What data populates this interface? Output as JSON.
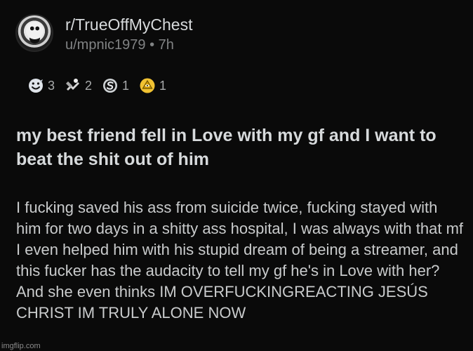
{
  "post": {
    "subreddit": "r/TrueOffMyChest",
    "author": "u/mpnic1979",
    "separator": "•",
    "age": "7h",
    "title": "my best friend fell in Love with my gf and I want to beat the shit out of him",
    "body": "I fucking saved his ass from suicide twice, fucking stayed with him for two days in a shitty ass hospital, I was always with that mf I even helped him with his stupid dream of being a streamer, and this fucker has the audacity to tell my gf he's in Love with her? And she even thinks IM OVERFUCKINGREACTING JESÚS CHRIST IM TRULY ALONE NOW"
  },
  "awards": [
    {
      "icon": "wholesome-award-icon",
      "count": "3"
    },
    {
      "icon": "helpful-award-icon",
      "count": "2"
    },
    {
      "icon": "silver-award-icon",
      "count": "1"
    },
    {
      "icon": "gold-award-icon",
      "count": "1"
    }
  ],
  "watermark": "imgflip.com"
}
